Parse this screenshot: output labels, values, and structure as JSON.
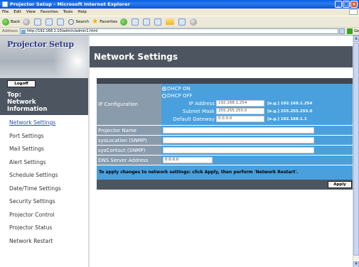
{
  "window": {
    "title": "Projector Setup - Microsoft Internet Explorer",
    "minimize_glyph": "_",
    "maximize_glyph": "□",
    "close_glyph": "×"
  },
  "menubar": {
    "items": [
      "File",
      "Edit",
      "View",
      "Favorites",
      "Tools",
      "Help"
    ]
  },
  "toolbar": {
    "back_label": "Back",
    "search_label": "Search",
    "favorites_label": "Favorites"
  },
  "addressbar": {
    "label": "Address",
    "url": "http://192.168.1.10/admin/admin1.html",
    "go_label": "Go"
  },
  "sidebar": {
    "brand": "Projector Setup",
    "logoff_label": "Logoff",
    "section_title_lines": [
      "Top:",
      "Network",
      "Information"
    ],
    "items": [
      {
        "label": "Network Settings",
        "active": true
      },
      {
        "label": "Port Settings",
        "active": false
      },
      {
        "label": "Mail Settings",
        "active": false
      },
      {
        "label": "Alert Settings",
        "active": false
      },
      {
        "label": "Schedule Settings",
        "active": false
      },
      {
        "label": "Date/Time Settings",
        "active": false
      },
      {
        "label": "Security Settings",
        "active": false
      },
      {
        "label": "Projector Control",
        "active": false
      },
      {
        "label": "Projector Status",
        "active": false
      },
      {
        "label": "Network Restart",
        "active": false
      }
    ]
  },
  "main": {
    "page_title": "Network Settings",
    "ip_configuration": {
      "label": "IP Configuration",
      "dhcp_on_label": "DHCP ON",
      "dhcp_off_label": "DHCP OFF",
      "selected": "DHCP ON",
      "ip_address_label": "IP Address",
      "ip_address_value": "192.168.1.254",
      "ip_address_example": "[e.g.] 192.168.1.254",
      "subnet_mask_label": "Subnet Mask",
      "subnet_mask_value": "255.255.255.0",
      "subnet_mask_example": "[e.g.] 255.255.255.0",
      "default_gateway_label": "Default Gateway",
      "default_gateway_value": "0.0.0.0",
      "default_gateway_example": "[e.g.] 192.168.1.1"
    },
    "projector_name_label": "Projector Name",
    "projector_name_value": "",
    "syslocation_label": "sysLocation (SNMP)",
    "syslocation_value": "",
    "syscontact_label": "sysContact (SNMP)",
    "syscontact_value": "",
    "dns_label": "DNS Server Address",
    "dns_value": "0.0.0.0",
    "notice": "To apply changes to network settings: click Apply, then perform 'Network Restart'.",
    "apply_label": "Apply"
  },
  "colors": {
    "nav_bg": "#4d5660",
    "label_bg": "#8a9bac",
    "value_bg": "#4aa0dc",
    "active_link": "#2b4ea8",
    "brand_text": "#2c3a86"
  }
}
